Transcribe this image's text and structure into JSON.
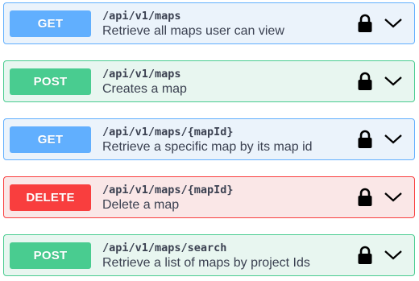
{
  "operations": [
    {
      "method": "GET",
      "path": "/api/v1/maps",
      "summary": "Retrieve all maps user can view",
      "lock_icon": "lock-icon",
      "expand_icon": "chevron-down-icon"
    },
    {
      "method": "POST",
      "path": "/api/v1/maps",
      "summary": "Creates a map",
      "lock_icon": "lock-icon",
      "expand_icon": "chevron-down-icon"
    },
    {
      "method": "GET",
      "path": "/api/v1/maps/{mapId}",
      "summary": "Retrieve a specific map by its map id",
      "lock_icon": "lock-icon",
      "expand_icon": "chevron-down-icon"
    },
    {
      "method": "DELETE",
      "path": "/api/v1/maps/{mapId}",
      "summary": "Delete a map",
      "lock_icon": "lock-icon",
      "expand_icon": "chevron-down-icon"
    },
    {
      "method": "POST",
      "path": "/api/v1/maps/search",
      "summary": "Retrieve a list of maps by project Ids",
      "lock_icon": "lock-icon",
      "expand_icon": "chevron-down-icon"
    }
  ],
  "colors": {
    "get": "#61affe",
    "post": "#49cc90",
    "delete": "#f93e3e",
    "text": "#3b4151"
  }
}
